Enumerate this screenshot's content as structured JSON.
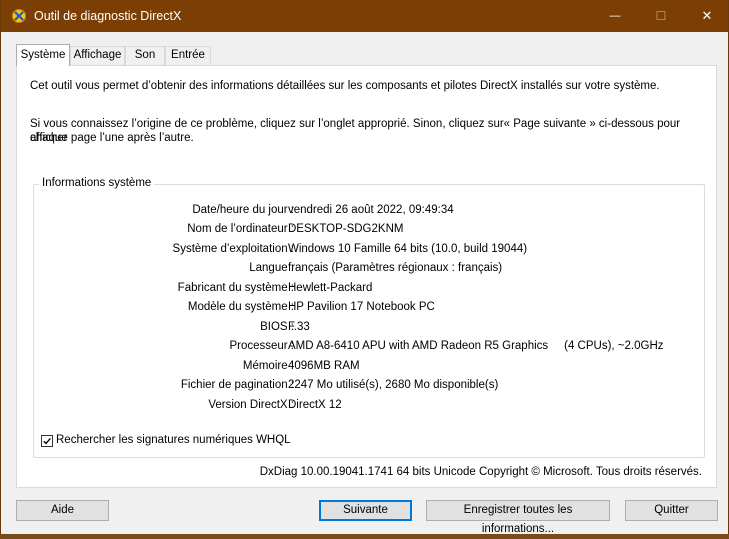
{
  "window": {
    "title": "Outil de diagnostic DirectX",
    "controls": {
      "minimize": "—",
      "maximize": "☐",
      "close": "✕"
    }
  },
  "tabs": [
    {
      "label": "Système",
      "active": true
    },
    {
      "label": "Affichage",
      "active": false
    },
    {
      "label": "Son",
      "active": false
    },
    {
      "label": "Entrée",
      "active": false
    }
  ],
  "intro": {
    "line1": "Cet outil vous permet d’obtenir des informations détaillées sur les composants et pilotes DirectX installés sur votre système.",
    "line2": "Si vous connaissez l’origine de ce problème, cliquez sur l’onglet approprié. Sinon, cliquez sur« Page suivante » ci-dessous pour afficher",
    "line3": "chaque page l’une après l’autre."
  },
  "system_info": {
    "title": "Informations système",
    "rows": [
      {
        "label": "Date/heure du jour :",
        "value": "vendredi 26 août 2022, 09:49:34"
      },
      {
        "label": "Nom de l’ordinateur :",
        "value": "DESKTOP-SDG2KNM"
      },
      {
        "label": "Système d’exploitation :",
        "value": "Windows 10 Famille 64 bits (10.0, build 19044)"
      },
      {
        "label": "Langue :",
        "value": "français (Paramètres régionaux : français)"
      },
      {
        "label": "Fabricant du système :",
        "value": "Hewlett-Packard"
      },
      {
        "label": "Modèle du système :",
        "value": "HP Pavilion 17 Notebook PC"
      },
      {
        "label": "BIOS :",
        "value": "F.33"
      },
      {
        "label": "Processeur :",
        "value": "AMD A8-6410 APU with AMD Radeon R5 Graphics     (4 CPUs), ~2.0GHz"
      },
      {
        "label": "Mémoire :",
        "value": "4096MB RAM"
      },
      {
        "label": "Fichier de pagination :",
        "value": "2247 Mo utilisé(s), 2680 Mo disponible(s)"
      },
      {
        "label": "Version DirectX :",
        "value": "DirectX 12"
      }
    ],
    "whql_checkbox": {
      "label": "Rechercher les signatures numériques WHQL",
      "checked": true
    }
  },
  "footer": {
    "version": "DxDiag 10.00.19041.1741 64 bits Unicode Copyright © Microsoft. Tous droits réservés."
  },
  "buttons": {
    "help": "Aide",
    "next": "Suivante",
    "save_all": "Enregistrer toutes les informations...",
    "quit": "Quitter"
  },
  "colors": {
    "titlebar": "#7b3f06",
    "default_button_border": "#0078d7"
  }
}
